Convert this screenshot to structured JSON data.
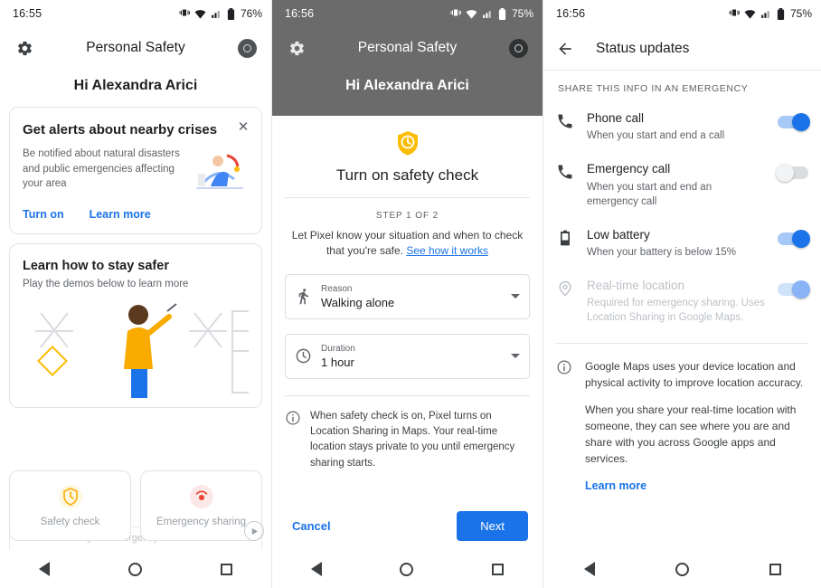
{
  "panel1": {
    "status": {
      "time": "16:55",
      "battery": "76%",
      "vibrate_icon": "vibrate-icon",
      "wifi_icon": "wifi-icon",
      "signal_icon": "signal-icon",
      "battery_icon": "battery-icon"
    },
    "appbar": {
      "title": "Personal Safety",
      "settings_icon": "gear-icon",
      "avatar": "avatar"
    },
    "greeting": "Hi Alexandra Arici",
    "card1": {
      "title": "Get alerts about nearby crises",
      "description": "Be notified about natural disasters and public emergencies affecting your area",
      "close_icon": "close-icon",
      "action_primary": "Turn on",
      "action_secondary": "Learn more",
      "illustration": "person-with-umbrella-illustration"
    },
    "card2": {
      "title": "Learn how to stay safer",
      "subtitle": "Play the demos below to learn more",
      "illustration": "person-waving-illustration"
    },
    "chips": [
      {
        "label": "Safety check",
        "icon": "safety-check-icon"
      },
      {
        "label": "Emergency sharing",
        "icon": "emergency-sharing-icon"
      }
    ],
    "ghost_row": "Share this with your emergency contacts",
    "nav": {
      "back": "back-button",
      "home": "home-button",
      "recents": "recents-button"
    }
  },
  "panel2": {
    "status": {
      "time": "16:56",
      "battery": "75%"
    },
    "appbar": {
      "title": "Personal Safety"
    },
    "greeting": "Hi Alexandra Arici",
    "sheet": {
      "icon": "safety-check-shield-icon",
      "title": "Turn on safety check",
      "step_label": "STEP 1 OF 2",
      "step_description_pre": "Let Pixel know your situation and when to check that you're safe. ",
      "step_description_link": "See how it works",
      "fields": [
        {
          "label": "Reason",
          "value": "Walking alone",
          "icon": "walking-person-icon"
        },
        {
          "label": "Duration",
          "value": "1 hour",
          "icon": "clock-icon"
        }
      ],
      "note_icon": "info-icon",
      "note": "When safety check is on, Pixel turns on Location Sharing in Maps. Your real-time location stays private to you until emergency sharing starts.",
      "cancel_label": "Cancel",
      "next_label": "Next"
    }
  },
  "panel3": {
    "status": {
      "time": "16:56",
      "battery": "75%"
    },
    "appbar": {
      "title": "Status updates",
      "back_icon": "back-arrow-icon"
    },
    "section_label": "SHARE THIS INFO IN AN EMERGENCY",
    "rows": [
      {
        "icon": "phone-icon",
        "title": "Phone call",
        "subtitle": "When you start and end a call",
        "toggle": "on",
        "disabled": false
      },
      {
        "icon": "phone-icon",
        "title": "Emergency call",
        "subtitle": "When you start and end an emergency call",
        "toggle": "off",
        "disabled": false
      },
      {
        "icon": "battery-low-icon",
        "title": "Low battery",
        "subtitle": "When your battery is below 15%",
        "toggle": "on",
        "disabled": false
      },
      {
        "icon": "location-pin-icon",
        "title": "Real-time location",
        "subtitle": "Required for emergency sharing. Uses Location Sharing in Google Maps.",
        "toggle": "faded",
        "disabled": true
      }
    ],
    "info_icon": "info-icon",
    "info_paragraphs": [
      "Google Maps uses your device location and physical activity to improve location accuracy.",
      "When you share your real-time location with someone, they can see where you are and share with you across Google apps and services."
    ],
    "info_link": "Learn more"
  },
  "colors": {
    "accent": "#1a73e8",
    "text": "#202124",
    "muted": "#5f6368",
    "dim_overlay": "#6b6b6b"
  }
}
